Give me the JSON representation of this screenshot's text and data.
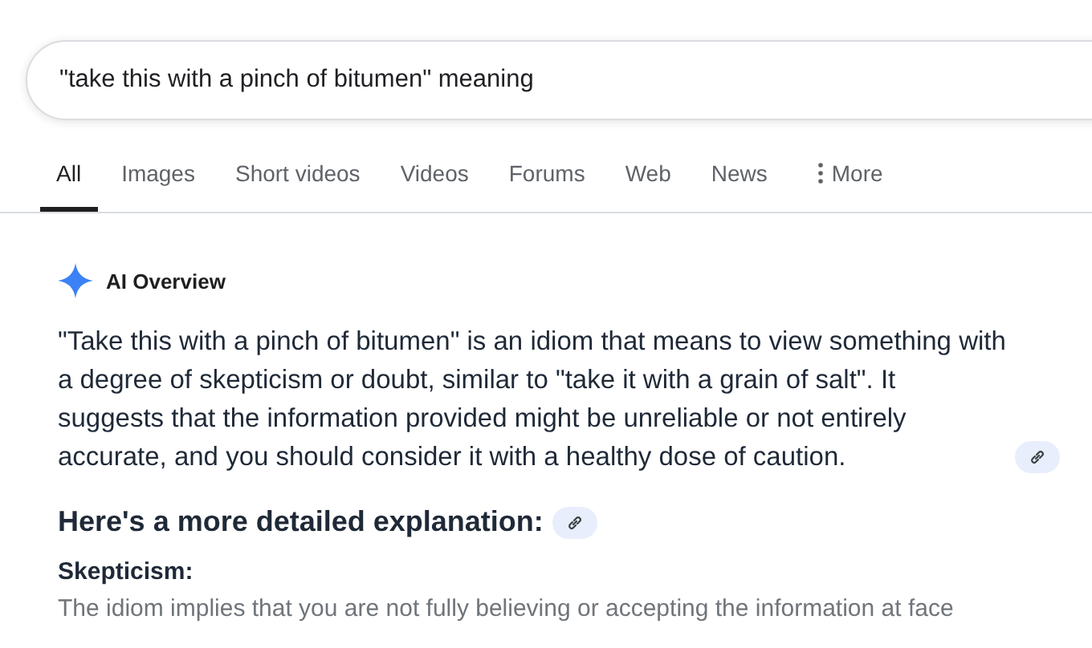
{
  "search": {
    "value": "\"take this with a pinch of bitumen\" meaning"
  },
  "tabs": [
    {
      "label": "All",
      "selected": true
    },
    {
      "label": "Images",
      "selected": false
    },
    {
      "label": "Short videos",
      "selected": false
    },
    {
      "label": "Videos",
      "selected": false
    },
    {
      "label": "Forums",
      "selected": false
    },
    {
      "label": "Web",
      "selected": false
    },
    {
      "label": "News",
      "selected": false
    },
    {
      "label": "More",
      "selected": false,
      "kind": "menu"
    }
  ],
  "ai_overview": {
    "label": "AI Overview",
    "summary": "\"Take this with a pinch of bitumen\" is an idiom that means to view something with a degree of skepticism or doubt, similar to \"take it with a grain of salt\". It suggests that the information provided might be unreliable or not entirely accurate, and you should consider it with a healthy dose of caution.",
    "heading": "Here's a more detailed explanation:",
    "points": [
      {
        "term": "Skepticism:",
        "text": "The idiom implies that you are not fully believing or accepting the information at face"
      }
    ]
  }
}
